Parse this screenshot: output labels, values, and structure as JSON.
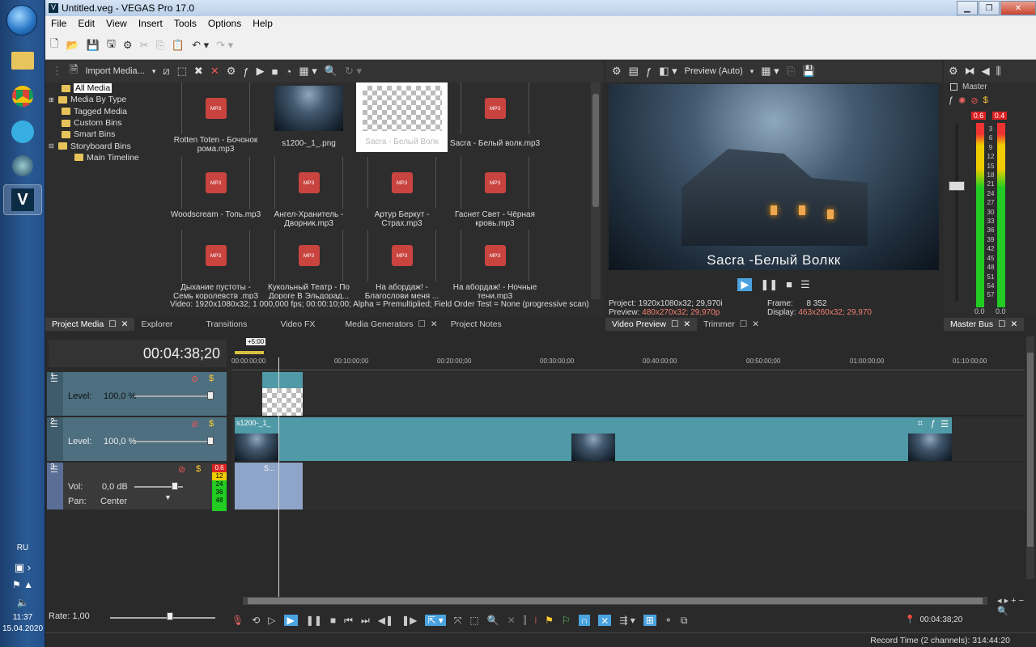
{
  "window": {
    "title": "Untitled.veg - VEGAS Pro 17.0"
  },
  "menu": [
    "File",
    "Edit",
    "View",
    "Insert",
    "Tools",
    "Options",
    "Help"
  ],
  "project_media": {
    "import_label": "Import Media...",
    "tree": [
      "All Media",
      "Media By Type",
      "Tagged Media",
      "Custom Bins",
      "Smart Bins",
      "Storyboard Bins",
      "Main Timeline"
    ],
    "items": [
      {
        "name": "Rotten Toten - Бочонок рома.mp3",
        "kind": "mp3"
      },
      {
        "name": "s1200-_1_.png",
        "kind": "image"
      },
      {
        "name": "Sacra - Белый Волк",
        "kind": "empty"
      },
      {
        "name": "Sacra - Белый волк.mp3",
        "kind": "mp3"
      },
      {
        "name": "Woodscream - Топь.mp3",
        "kind": "mp3"
      },
      {
        "name": "Ангел-Хранитель - Дворник.mp3",
        "kind": "mp3"
      },
      {
        "name": "Артур Беркут - Страх.mp3",
        "kind": "mp3"
      },
      {
        "name": "Гаснет Свет - Чёрная кровь.mp3",
        "kind": "mp3"
      },
      {
        "name": "Дыхание пустоты - Семь королевств .mp3",
        "kind": "mp3"
      },
      {
        "name": "Кукольный Театр - По Дороге В Эльдорад...",
        "kind": "mp3"
      },
      {
        "name": "На абордаж! - Благослови меня ...",
        "kind": "mp3"
      },
      {
        "name": "На абордаж! - Ночные тени.mp3",
        "kind": "mp3"
      }
    ],
    "mp3_badge": "MP3",
    "status": "Video: 1920x1080x32; 1 000,000 fps; 00:00:10;00; Alpha = Premultiplied; Field Order Test = None (progressive scan)"
  },
  "tabs_left": [
    "Project Media",
    "Explorer",
    "Transitions",
    "Video FX",
    "Media Generators",
    "Project Notes"
  ],
  "preview": {
    "mode": "Preview (Auto)",
    "overlay_text": "Sacra -Белый Волкк",
    "project_label": "Project:",
    "project_value": "1920x1080x32; 29,970i",
    "preview_label": "Preview:",
    "preview_value": "480x270x32; 29,970p",
    "frame_label": "Frame:",
    "frame_value": "8 352",
    "display_label": "Display:",
    "display_value": "463x260x32; 29,970"
  },
  "tabs_mid": [
    "Video Preview",
    "Trimmer"
  ],
  "master": {
    "label": "Master",
    "peak_left": "0.6",
    "peak_right": "0.4",
    "scale": [
      "3",
      "6",
      "9",
      "12",
      "15",
      "18",
      "21",
      "24",
      "27",
      "30",
      "33",
      "36",
      "39",
      "42",
      "45",
      "48",
      "51",
      "54",
      "57"
    ],
    "bottom_left": "0.0",
    "bottom_right": "0.0",
    "tab": "Master Bus"
  },
  "timeline": {
    "timecode": "00:04:38;20",
    "marker": "+5:00",
    "ruler": [
      "00:00:00;00",
      "00:10:00;00",
      "00:20:00;00",
      "00:30:00;00",
      "00:40:00;00",
      "00:50:00;00",
      "01:00:00;00",
      "01:10:00;00"
    ],
    "tracks": [
      {
        "num": "1",
        "level_label": "Level:",
        "level": "100,0 %"
      },
      {
        "num": "2",
        "level_label": "Level:",
        "level": "100,0 %",
        "clip": "s1200-_1_"
      },
      {
        "num": "3",
        "vol_label": "Vol:",
        "vol": "0,0 dB",
        "pan_label": "Pan:",
        "pan": "Center",
        "clip": "S..."
      }
    ],
    "audio_meter": [
      "0.6",
      "12",
      "24",
      "36",
      "48"
    ],
    "rate_label": "Rate: 1,00",
    "cursor_time": "00:04:38;20",
    "record_time": "Record Time (2 channels): 314:44:20"
  },
  "tray": {
    "lang": "RU",
    "time": "11:37",
    "date": "15.04.2020"
  },
  "colors": {
    "accent": "#4aa3df",
    "track_video": "#4f9aa6",
    "track_audio": "#8ea4c8",
    "mp3": "#c9443f"
  }
}
